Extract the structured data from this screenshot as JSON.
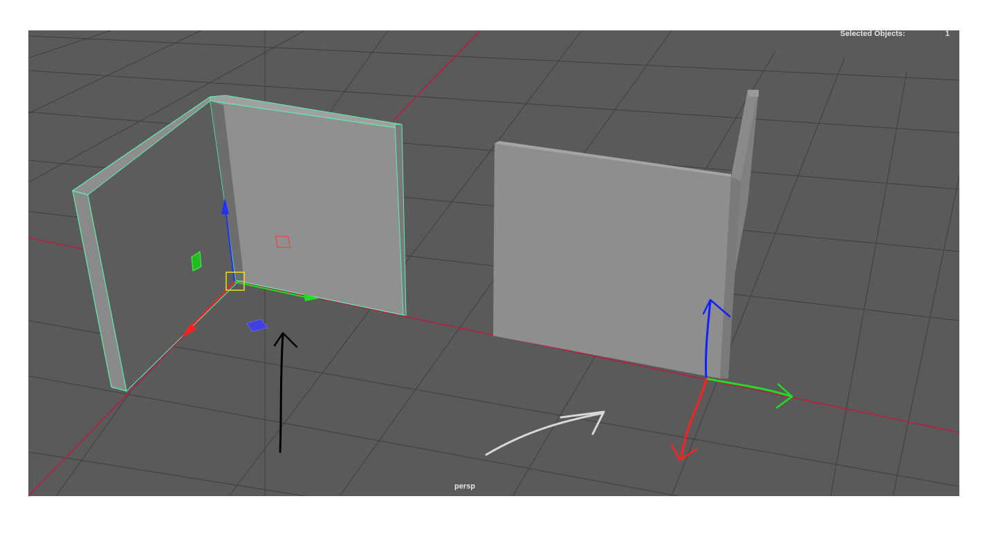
{
  "viewport": {
    "camera_name": "persp"
  },
  "hud": {
    "selected_objects_label": "Selected Objects:",
    "selected_objects_count": "1"
  },
  "colors": {
    "viewport_background": "#5a5a5a",
    "grid_line": "#3c3c3c",
    "axis_line": "#b0213a",
    "selection_highlight": "#5ef0b0",
    "manipulator_x": "#ff2020",
    "manipulator_y": "#22dd22",
    "manipulator_z": "#2030ff",
    "pivot_box": "#f0e020"
  },
  "icons": {
    "move_manipulator": "move-tool-manipulator-icon",
    "annotation_arrows": "hand-drawn-arrow-icon"
  }
}
